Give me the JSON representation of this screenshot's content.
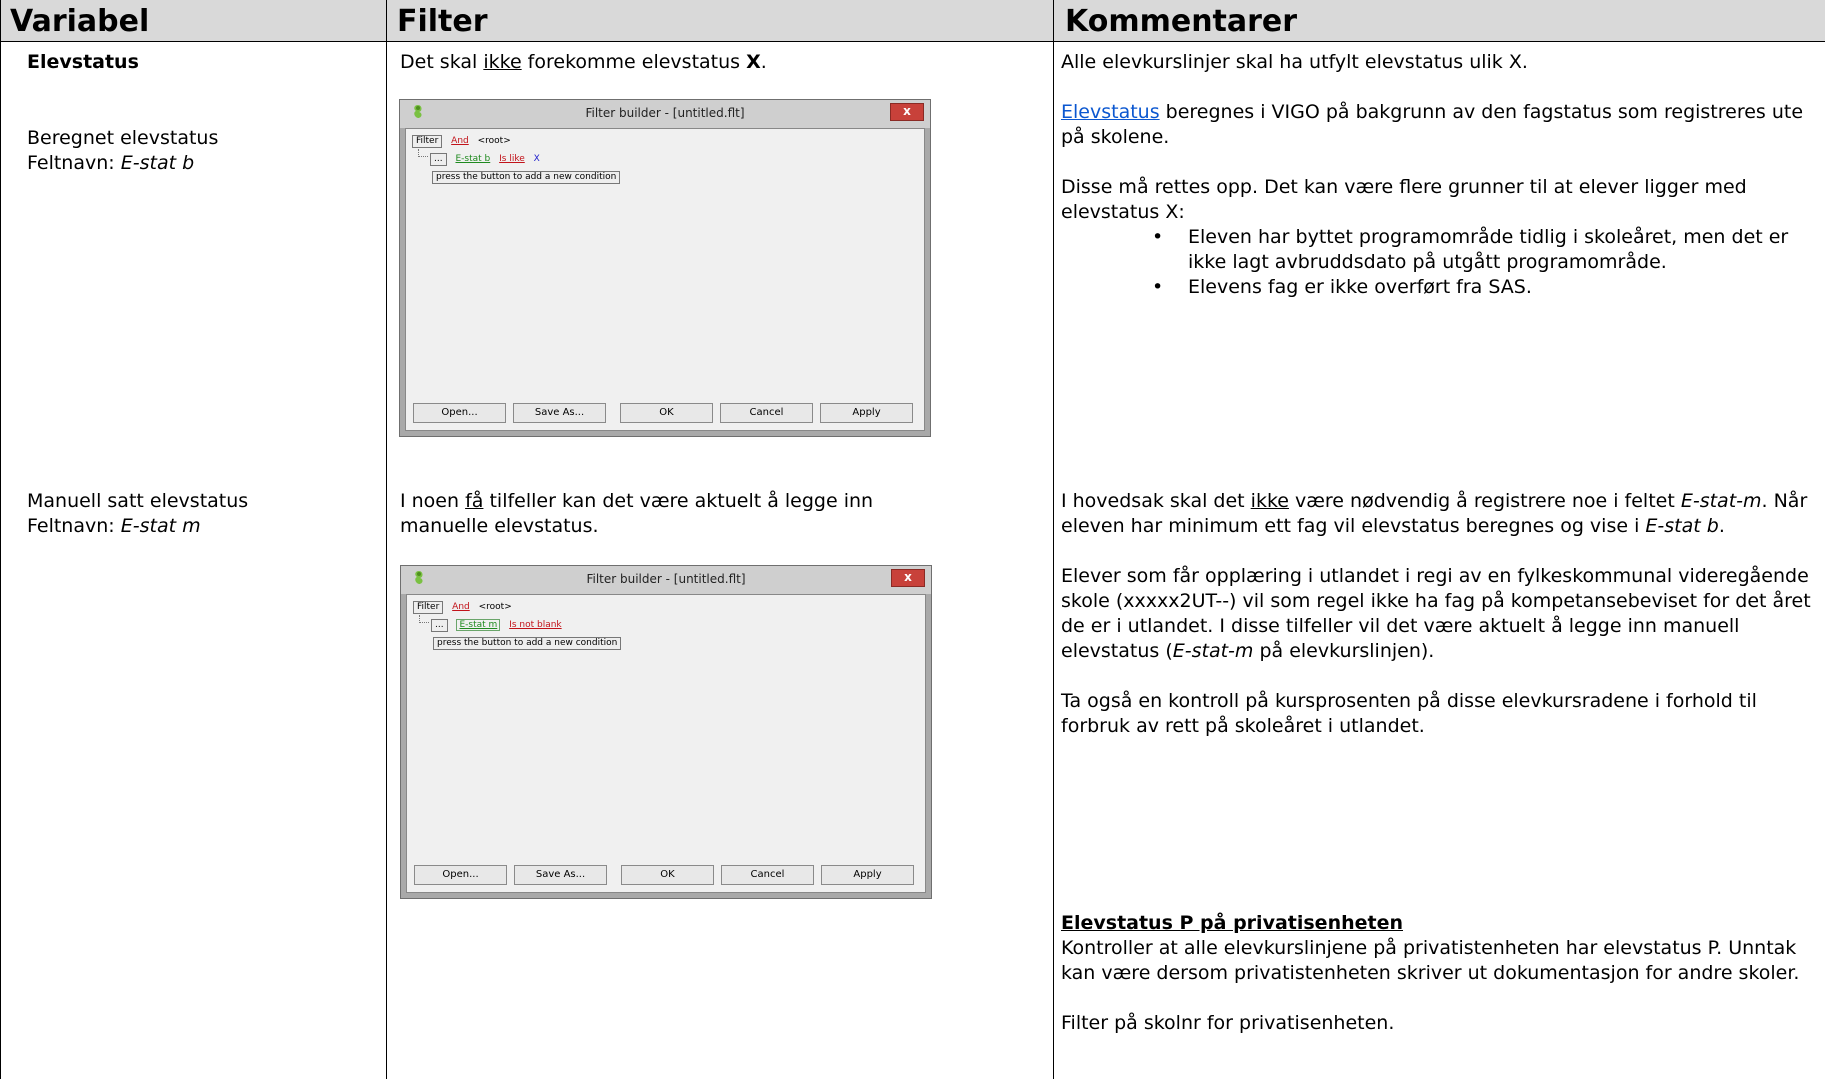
{
  "headers": {
    "variabel": "Variabel",
    "filter": "Filter",
    "kommentarer": "Kommentarer"
  },
  "row1": {
    "variabel_title": "Elevstatus",
    "variabel_line1": "Beregnet elevstatus",
    "variabel_line2_prefix": "Feltnavn: ",
    "variabel_line2_field": "E-stat b",
    "filter_text_a": "Det skal ",
    "filter_text_u": "ikke",
    "filter_text_b": " forekomme elevstatus ",
    "filter_text_bold": "X",
    "filter_text_c": ".",
    "comment_p1": "Alle elevkurslinjer skal ha utfylt elevstatus ulik X.",
    "comment_p2_link": "Elevstatus",
    "comment_p2_rest": " beregnes i VIGO på bakgrunn av den fagstatus som registreres ute på skolene.",
    "comment_p3": "Disse må rettes opp. Det kan være flere grunner til at elever ligger med elevstatus X:",
    "comment_bullets": [
      "Eleven har byttet programområde tidlig i skoleåret, men det er ikke lagt avbruddsdato på utgått programområde.",
      "Elevens fag er ikke overført fra SAS."
    ]
  },
  "row2": {
    "variabel_line1": "Manuell satt elevstatus",
    "variabel_line2_prefix": "Feltnavn: ",
    "variabel_line2_field": "E-stat m",
    "filter_text_a": "I noen ",
    "filter_text_u": "få",
    "filter_text_b": " tilfeller kan det være aktuelt å legge inn manuelle elevstatus.",
    "comment_p1_a": "I hovedsak skal det ",
    "comment_p1_u": "ikke",
    "comment_p1_b": " være nødvendig å registrere noe i feltet ",
    "comment_p1_i": "E-stat-m",
    "comment_p1_c": ". Når eleven har minimum ett fag vil elevstatus beregnes og vise i ",
    "comment_p1_i2": "E-stat b",
    "comment_p1_d": ".",
    "comment_p2_a": "Elever som får opplæring i utlandet i regi av en fylkeskommunal videregående skole (xxxxx2UT--) vil som regel ikke ha fag på kompetansebeviset for det året de er i utlandet. I disse tilfeller vil det være aktuelt å legge inn manuell elevstatus (",
    "comment_p2_i": "E-stat-m",
    "comment_p2_b": " på elevkurslinjen).",
    "comment_p3": "Ta også en kontroll på kursprosenten på disse elevkursradene i forhold til forbruk av rett på skoleåret i utlandet.",
    "comment_heading": "Elevstatus P på privatisenheten",
    "comment_p4": "Kontroller at alle elevkurslinjene på privatistenheten har elevstatus P. Unntak kan være dersom privatistenheten skriver ut dokumentasjon for andre skoler.",
    "comment_p5": "Filter på skolnr for privatisenheten."
  },
  "dialog1": {
    "title": "Filter builder - [untitled.flt]",
    "close": "x",
    "filter_tag": "Filter",
    "and_label": "And",
    "root_label": "<root>",
    "dots": "...",
    "field": "E-stat b",
    "operator": "Is like",
    "value": "X",
    "hint": "press the button to add a new condition",
    "buttons": [
      "Open...",
      "Save As...",
      "OK",
      "Cancel",
      "Apply"
    ]
  },
  "dialog2": {
    "title": "Filter builder - [untitled.flt]",
    "close": "x",
    "filter_tag": "Filter",
    "and_label": "And",
    "root_label": "<root>",
    "dots": "...",
    "field": "E-stat m",
    "operator": "Is not blank",
    "hint": "press the button to add a new condition",
    "buttons": [
      "Open...",
      "Save As...",
      "OK",
      "Cancel",
      "Apply"
    ]
  }
}
